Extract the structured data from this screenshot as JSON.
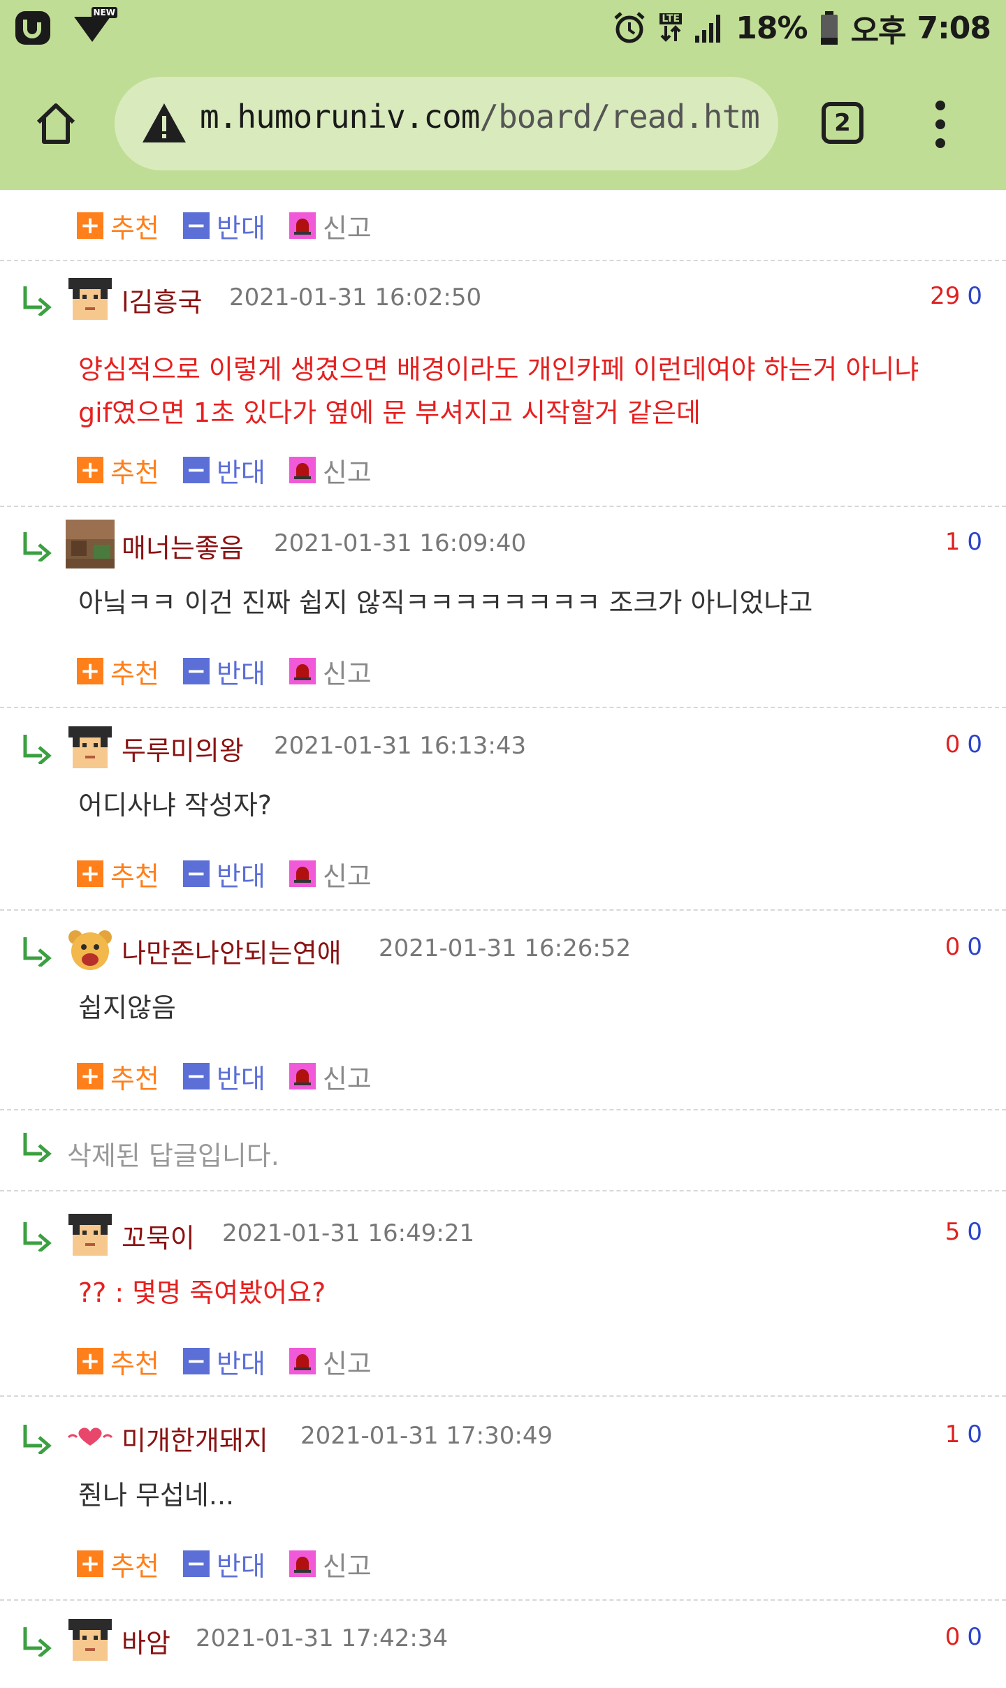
{
  "status_bar": {
    "battery": "18%",
    "ampm": "오후",
    "time": "7:08",
    "lte_label": "LTE",
    "new_badge": "NEW"
  },
  "browser": {
    "url_host": "m.humoruniv.com",
    "url_path": "/board/read.htm",
    "tab_count": "2"
  },
  "actions": {
    "recommend": "추천",
    "oppose": "반대",
    "report": "신고"
  },
  "comments": [
    {
      "name": "l김흥국",
      "date": "2021-01-31 16:02:50",
      "up": "29",
      "down": "0",
      "lines": [
        "양심적으로 이렇게 생겼으면 배경이라도 개인카페 이런데여야 하는거 아니냐",
        "gif였으면 1초 있다가 옆에 문 부셔지고 시작할거 같은데"
      ],
      "red": true
    },
    {
      "name": "매너는좋음",
      "date": "2021-01-31 16:09:40",
      "up": "1",
      "down": "0",
      "lines": [
        "아닠ㅋㅋ 이건 진짜 쉽지 않직ㅋㅋㅋㅋㅋㅋㅋㅋ 조크가 아니었냐고"
      ],
      "red": false
    },
    {
      "name": "두루미의왕",
      "date": "2021-01-31 16:13:43",
      "up": "0",
      "down": "0",
      "lines": [
        "어디사냐 작성자?"
      ],
      "red": false
    },
    {
      "name": "나만존나안되는연애",
      "date": "2021-01-31 16:26:52",
      "up": "0",
      "down": "0",
      "lines": [
        "쉽지않음"
      ],
      "red": false
    },
    {
      "name": "꼬묵이",
      "date": "2021-01-31 16:49:21",
      "up": "5",
      "down": "0",
      "lines": [
        "?? : 몇명 죽여봤어요?"
      ],
      "red": true
    },
    {
      "name": "미개한개돼지",
      "date": "2021-01-31 17:30:49",
      "up": "1",
      "down": "0",
      "lines": [
        "줜나 무섭네..."
      ],
      "red": false
    },
    {
      "name": "바암",
      "date": "2021-01-31 17:42:34",
      "up": "0",
      "down": "0",
      "lines": [],
      "red": false
    }
  ],
  "deleted_reply": "삭제된 답글입니다.",
  "colors": {
    "chrome_bg": "#c0dd95",
    "recommend": "#ff7f1a",
    "oppose": "#5b6fd6",
    "report": "#f05ad8",
    "name": "#8a1212",
    "up_vote": "#e02020",
    "down_vote": "#2a44c8"
  }
}
